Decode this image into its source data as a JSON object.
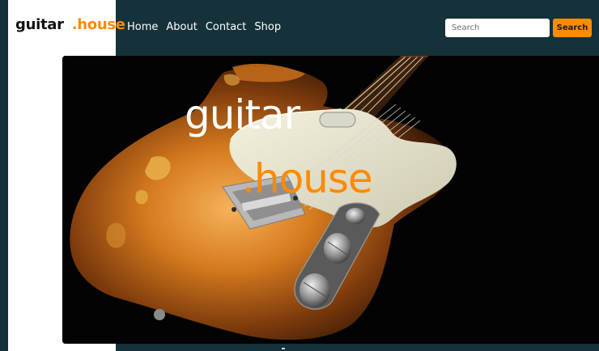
{
  "brand": {
    "name_part1": "guitar",
    "name_part2": ".house"
  },
  "nav": {
    "items": [
      {
        "label": "Home"
      },
      {
        "label": "About"
      },
      {
        "label": "Contact"
      },
      {
        "label": "Shop"
      }
    ]
  },
  "search": {
    "placeholder": "Search",
    "value": "",
    "button_label": "Search"
  },
  "hero": {
    "title_line1": "guitar",
    "title_line2": ".house"
  },
  "colors": {
    "header_bg": "#15313a",
    "accent": "#ff8c00",
    "logo_dark": "#111111",
    "text_light": "#ffffff"
  },
  "icons": {
    "hero_image": "electric-guitar-photo"
  }
}
